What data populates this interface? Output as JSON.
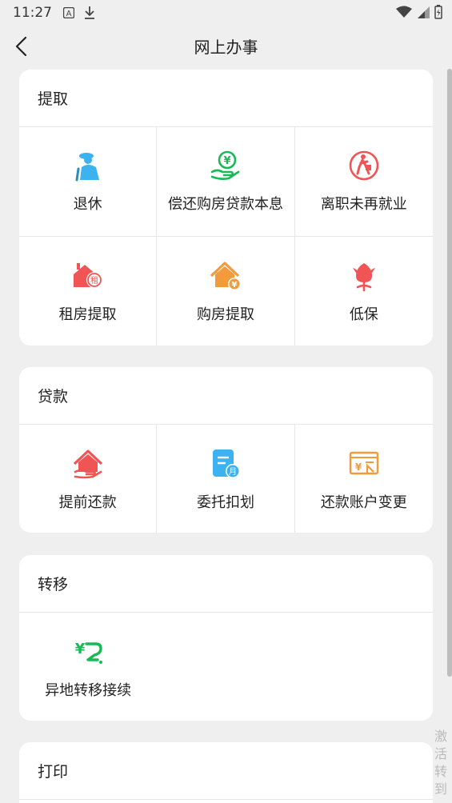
{
  "status_bar": {
    "time": "11:27",
    "icons": [
      "a-icon",
      "download-icon",
      "wifi-icon",
      "signal-icon",
      "battery-icon"
    ]
  },
  "nav": {
    "title": "网上办事",
    "back_icon": "chevron-left-icon"
  },
  "sections": [
    {
      "title": "提取",
      "items": [
        {
          "label": "退休",
          "icon": "retiree-icon",
          "color": "#3db2f0"
        },
        {
          "label": "偿还购房贷款本息",
          "icon": "hand-money-icon",
          "color": "#19b957"
        },
        {
          "label": "离职未再就业",
          "icon": "walking-person-icon",
          "color": "#f05454"
        },
        {
          "label": "租房提取",
          "icon": "rent-house-icon",
          "color": "#f05454"
        },
        {
          "label": "购房提取",
          "icon": "buy-house-icon",
          "color": "#f39a3a"
        },
        {
          "label": "低保",
          "icon": "flower-icon",
          "color": "#f05454"
        }
      ]
    },
    {
      "title": "贷款",
      "items": [
        {
          "label": "提前还款",
          "icon": "house-hand-icon",
          "color": "#f05454"
        },
        {
          "label": "委托扣划",
          "icon": "document-month-icon",
          "color": "#3db2f0"
        },
        {
          "label": "还款账户变更",
          "icon": "account-card-icon",
          "color": "#f39a3a"
        }
      ]
    },
    {
      "title": "转移",
      "items": [
        {
          "label": "异地转移接续",
          "icon": "transfer-yen-icon",
          "color": "#19b957"
        }
      ]
    },
    {
      "title": "打印",
      "items": []
    }
  ],
  "side_text": "激活转到"
}
